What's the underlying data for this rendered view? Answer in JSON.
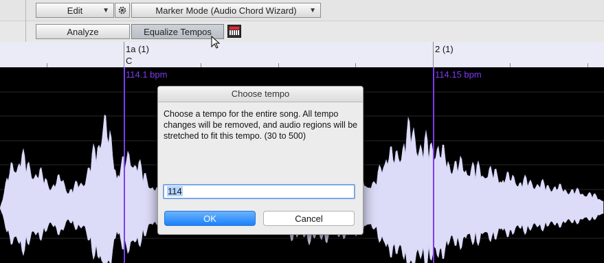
{
  "toolbar": {
    "edit_label": "Edit",
    "marker_mode_label": "Marker Mode (Audio Chord Wizard)",
    "analyze_label": "Analyze",
    "equalize_label": "Equalize Tempos",
    "icons": [
      "gear-icon",
      "piano-keyboard-icon",
      "dropdown-arrow-icon"
    ]
  },
  "ruler": {
    "marker1": "1a (1)",
    "chord1": "C",
    "marker2": "2 (1)"
  },
  "waveform": {
    "bpm1": "114.1 bpm",
    "bpm2": "114.15 bpm",
    "background_color": "#000000",
    "wave_color": "#dcdcf8",
    "marker_color": "#7d3cf0"
  },
  "dialog": {
    "title": "Choose tempo",
    "message": "Choose a tempo for the entire song. All tempo changes will be removed, and audio regions will be stretched to fit this tempo. (30 to 500)",
    "input_value": "114",
    "ok_label": "OK",
    "cancel_label": "Cancel"
  }
}
